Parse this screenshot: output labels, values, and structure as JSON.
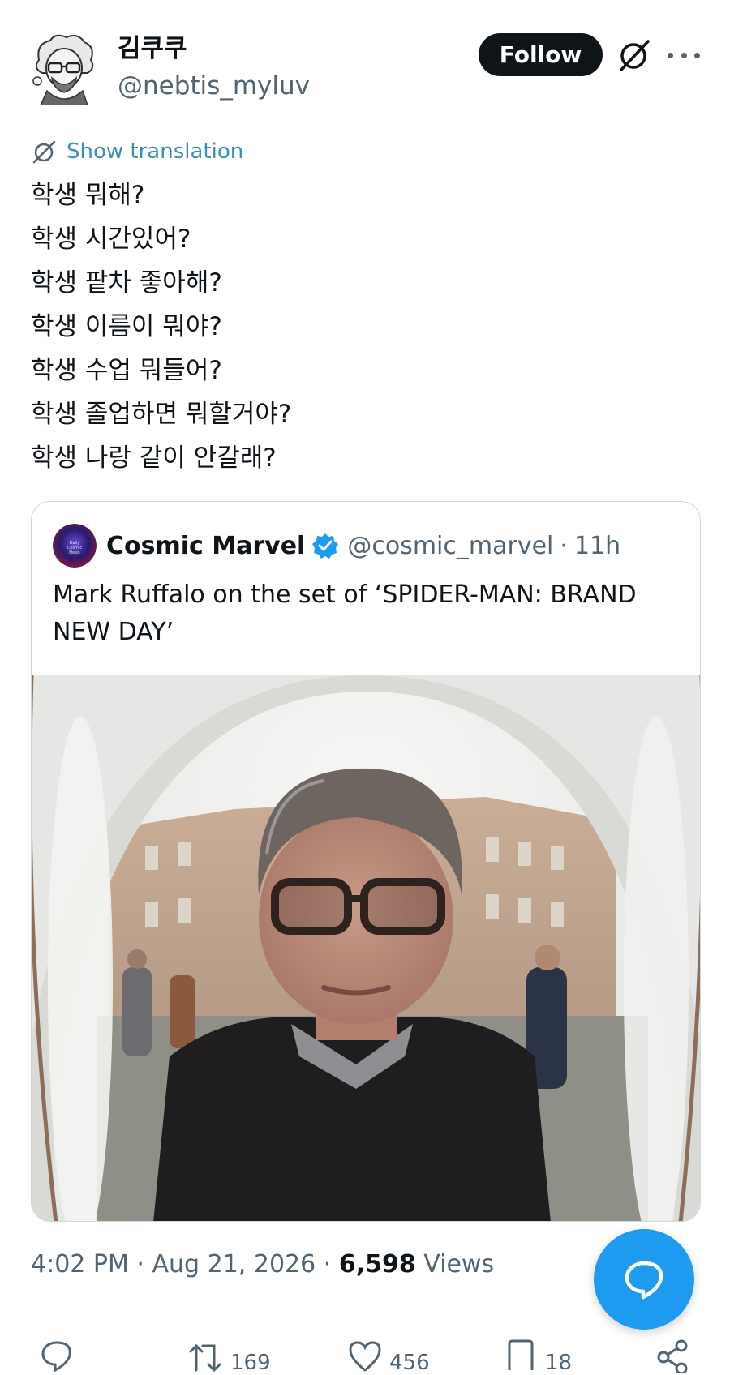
{
  "author": {
    "display_name": "김쿠쿠",
    "handle": "@nebtis_myluv",
    "avatar_icon": "cartoon-avatar-icon"
  },
  "header": {
    "follow_label": "Follow",
    "grok_icon": "grok-icon",
    "more_icon": "more-icon"
  },
  "translation": {
    "label": "Show translation",
    "icon": "translate-icon"
  },
  "post": {
    "lines": [
      "학생 뭐해?",
      "학생 시간있어?",
      "학생 팥차 좋아해?",
      "학생 이름이 뭐야?",
      "학생 수업 뭐들어?",
      "학생 졸업하면 뭐할거야?",
      "학생 나랑 같이 안갈래?"
    ]
  },
  "quote": {
    "name": "Cosmic Marvel",
    "verified_icon": "verified-badge-icon",
    "handle": "@cosmic_marvel",
    "separator": "·",
    "time": "11h",
    "text": "Mark Ruffalo on the set of ‘SPIDER-MAN: BRAND NEW DAY’",
    "avatar_text": "Daily Cosmic News"
  },
  "meta": {
    "time": "4:02 PM",
    "sep1": " · ",
    "date": "Aug 21, 2026",
    "sep2": " · ",
    "views_count": "6,598",
    "views_label": " Views"
  },
  "actions": {
    "reply_count": "",
    "repost_count": "169",
    "like_count": "456",
    "bookmark_count": "18"
  },
  "colors": {
    "accent": "#1d9bf0",
    "text": "#0f1419",
    "secondary": "#536471",
    "border": "#cfd9de"
  }
}
